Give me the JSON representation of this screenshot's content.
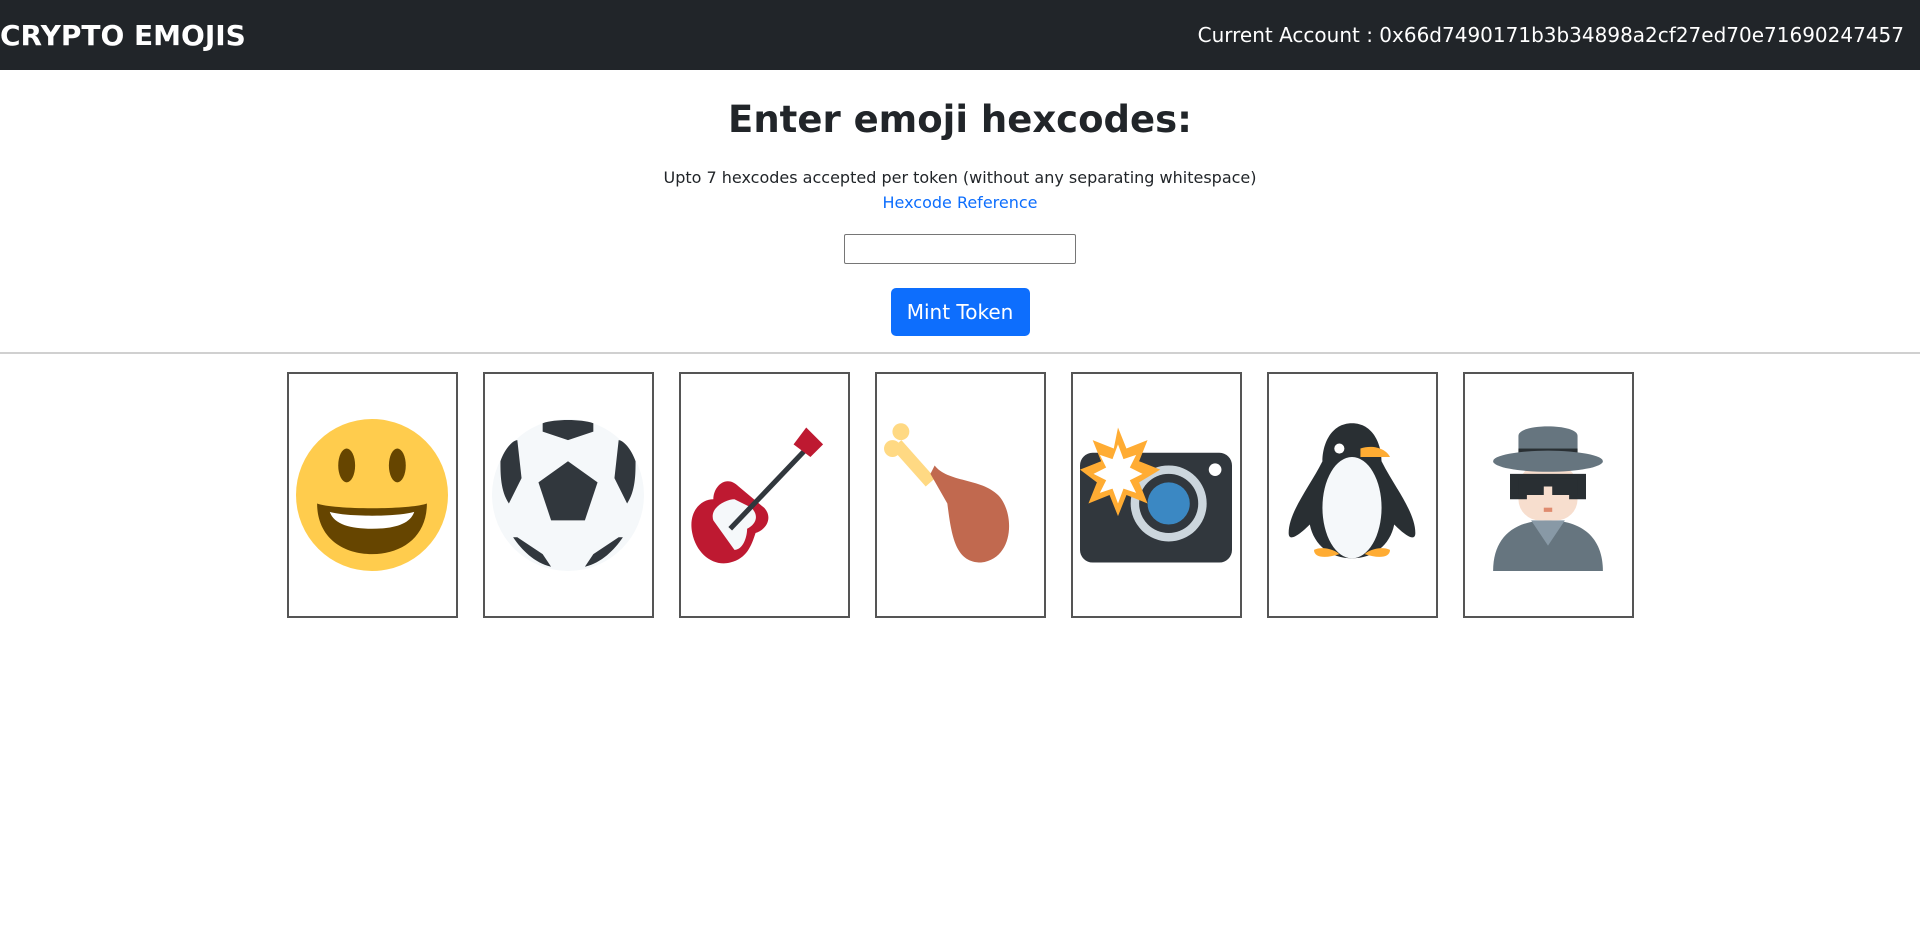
{
  "navbar": {
    "brand": "CRYPTO EMOJIS",
    "account_label": "Current Account : 0x66d7490171b3b34898a2cf27ed70e71690247457"
  },
  "form": {
    "heading": "Enter emoji hexcodes:",
    "subtext": "Upto 7 hexcodes accepted per token (without any separating whitespace)",
    "reference_link": "Hexcode Reference",
    "input_value": "",
    "mint_button": "Mint Token"
  },
  "tokens": [
    {
      "icon": "grinning-face-icon"
    },
    {
      "icon": "soccer-ball-icon"
    },
    {
      "icon": "guitar-icon"
    },
    {
      "icon": "poultry-leg-icon"
    },
    {
      "icon": "camera-with-flash-icon"
    },
    {
      "icon": "penguin-icon"
    },
    {
      "icon": "detective-icon"
    }
  ]
}
